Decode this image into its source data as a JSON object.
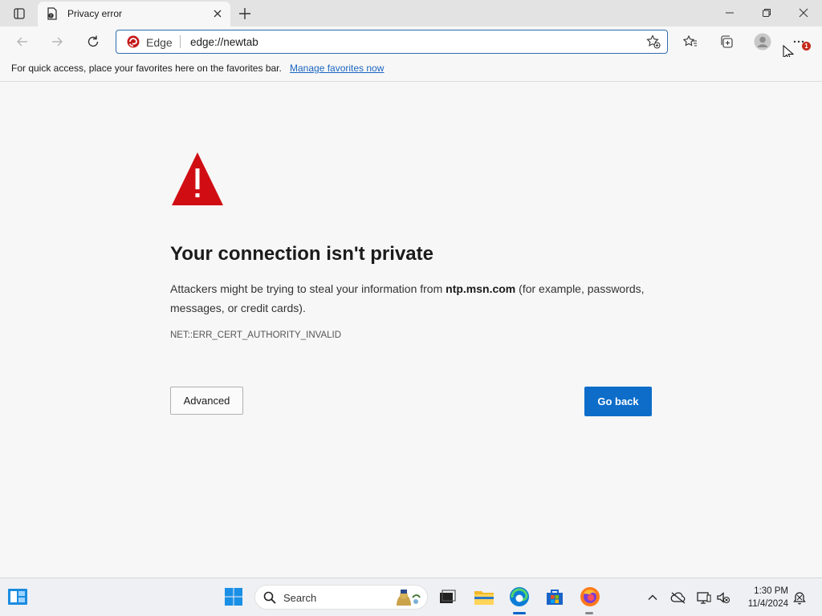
{
  "browser": {
    "tab": {
      "title": "Privacy error"
    },
    "address_bar": {
      "site_identity": "Edge",
      "url": "edge://newtab"
    },
    "notification_count": "1",
    "favorites_bar": {
      "message": "For quick access, place your favorites here on the favorites bar.",
      "link": "Manage favorites now"
    }
  },
  "error_page": {
    "title": "Your connection isn't private",
    "body_prefix": "Attackers might be trying to steal your information from ",
    "host": "ntp.msn.com",
    "body_suffix": " (for example, passwords, messages, or credit cards).",
    "error_code": "NET::ERR_CERT_AUTHORITY_INVALID",
    "advanced_label": "Advanced",
    "go_back_label": "Go back"
  },
  "taskbar": {
    "search_label": "Search",
    "clock": {
      "time": "1:30 PM",
      "date": "11/4/2024"
    }
  },
  "colors": {
    "accent": "#0d6dc9",
    "warning": "#d10d14",
    "link": "#1a66c0"
  },
  "icons": [
    "tab-actions-icon",
    "privacy-error-favicon",
    "close-icon",
    "plus-icon",
    "minimize-icon",
    "restore-icon",
    "back-arrow-icon",
    "forward-arrow-icon",
    "refresh-icon",
    "edge-logo-icon",
    "add-favorite-icon",
    "favorites-icon",
    "collections-icon",
    "profile-icon",
    "more-icon",
    "warning-triangle-icon",
    "widgets-icon",
    "start-icon",
    "search-icon",
    "task-view-icon",
    "file-explorer-icon",
    "edge-icon",
    "store-icon",
    "firefox-icon",
    "chevron-up-icon",
    "onedrive-icon",
    "network-icon",
    "volume-muted-icon",
    "notification-icon"
  ]
}
